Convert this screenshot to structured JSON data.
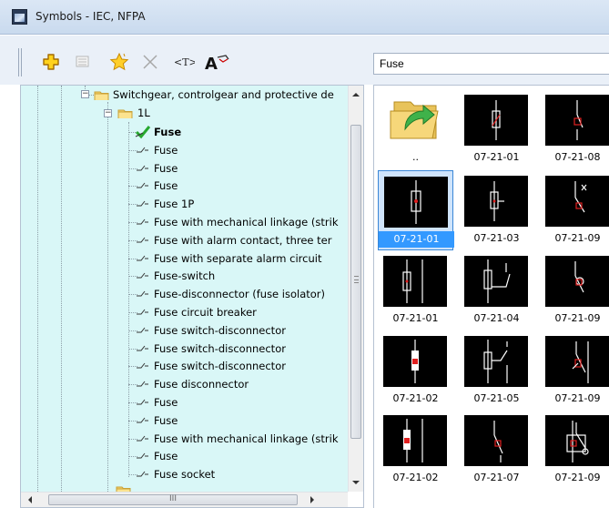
{
  "window": {
    "title": "Symbols - IEC, NFPA"
  },
  "toolbar": {
    "buttons": [
      {
        "name": "add-icon"
      },
      {
        "name": "properties-icon"
      },
      {
        "name": "favorite-star-icon"
      },
      {
        "name": "delete-x-icon"
      },
      {
        "name": "text-tag-icon"
      },
      {
        "name": "font-attribute-icon"
      }
    ],
    "filter_value": "Fuse"
  },
  "tree": {
    "parent_label": "Switchgear, controlgear and protective de",
    "folder_label": "1L",
    "items": [
      {
        "label": "Fuse",
        "checked": true,
        "bold": true
      },
      {
        "label": "Fuse"
      },
      {
        "label": "Fuse"
      },
      {
        "label": "Fuse"
      },
      {
        "label": "Fuse 1P"
      },
      {
        "label": "Fuse with mechanical linkage (strik"
      },
      {
        "label": "Fuse with alarm contact, three ter"
      },
      {
        "label": "Fuse with separate alarm circuit"
      },
      {
        "label": "Fuse-switch"
      },
      {
        "label": "Fuse-disconnector (fuse isolator)"
      },
      {
        "label": "Fuse circuit breaker"
      },
      {
        "label": "Fuse switch-disconnector"
      },
      {
        "label": "Fuse switch-disconnector"
      },
      {
        "label": "Fuse switch-disconnector"
      },
      {
        "label": "Fuse disconnector"
      },
      {
        "label": "Fuse"
      },
      {
        "label": "Fuse"
      },
      {
        "label": "Fuse with mechanical linkage (strik"
      },
      {
        "label": "Fuse"
      },
      {
        "label": "Fuse socket"
      }
    ],
    "hscroll_grip": "III"
  },
  "grid": {
    "tiles": [
      {
        "caption": "..",
        "kind": "up-folder"
      },
      {
        "caption": "07-21-01",
        "kind": "fuse-a"
      },
      {
        "caption": "07-21-08",
        "kind": "switch-a"
      },
      {
        "caption": "07-21-01",
        "kind": "fuse-box",
        "selected": true
      },
      {
        "caption": "07-21-03",
        "kind": "fuse-tap"
      },
      {
        "caption": "07-21-09",
        "kind": "switch-b"
      },
      {
        "caption": "07-21-01",
        "kind": "fuse-double"
      },
      {
        "caption": "07-21-04",
        "kind": "fuse-contact"
      },
      {
        "caption": "07-21-09",
        "kind": "switch-c"
      },
      {
        "caption": "07-21-02",
        "kind": "fuse-red"
      },
      {
        "caption": "07-21-05",
        "kind": "fuse-switch"
      },
      {
        "caption": "07-21-09",
        "kind": "switch-d"
      },
      {
        "caption": "07-21-02",
        "kind": "fuse-double-b"
      },
      {
        "caption": "07-21-07",
        "kind": "switch-e"
      },
      {
        "caption": "07-21-09",
        "kind": "switch-f"
      }
    ]
  }
}
